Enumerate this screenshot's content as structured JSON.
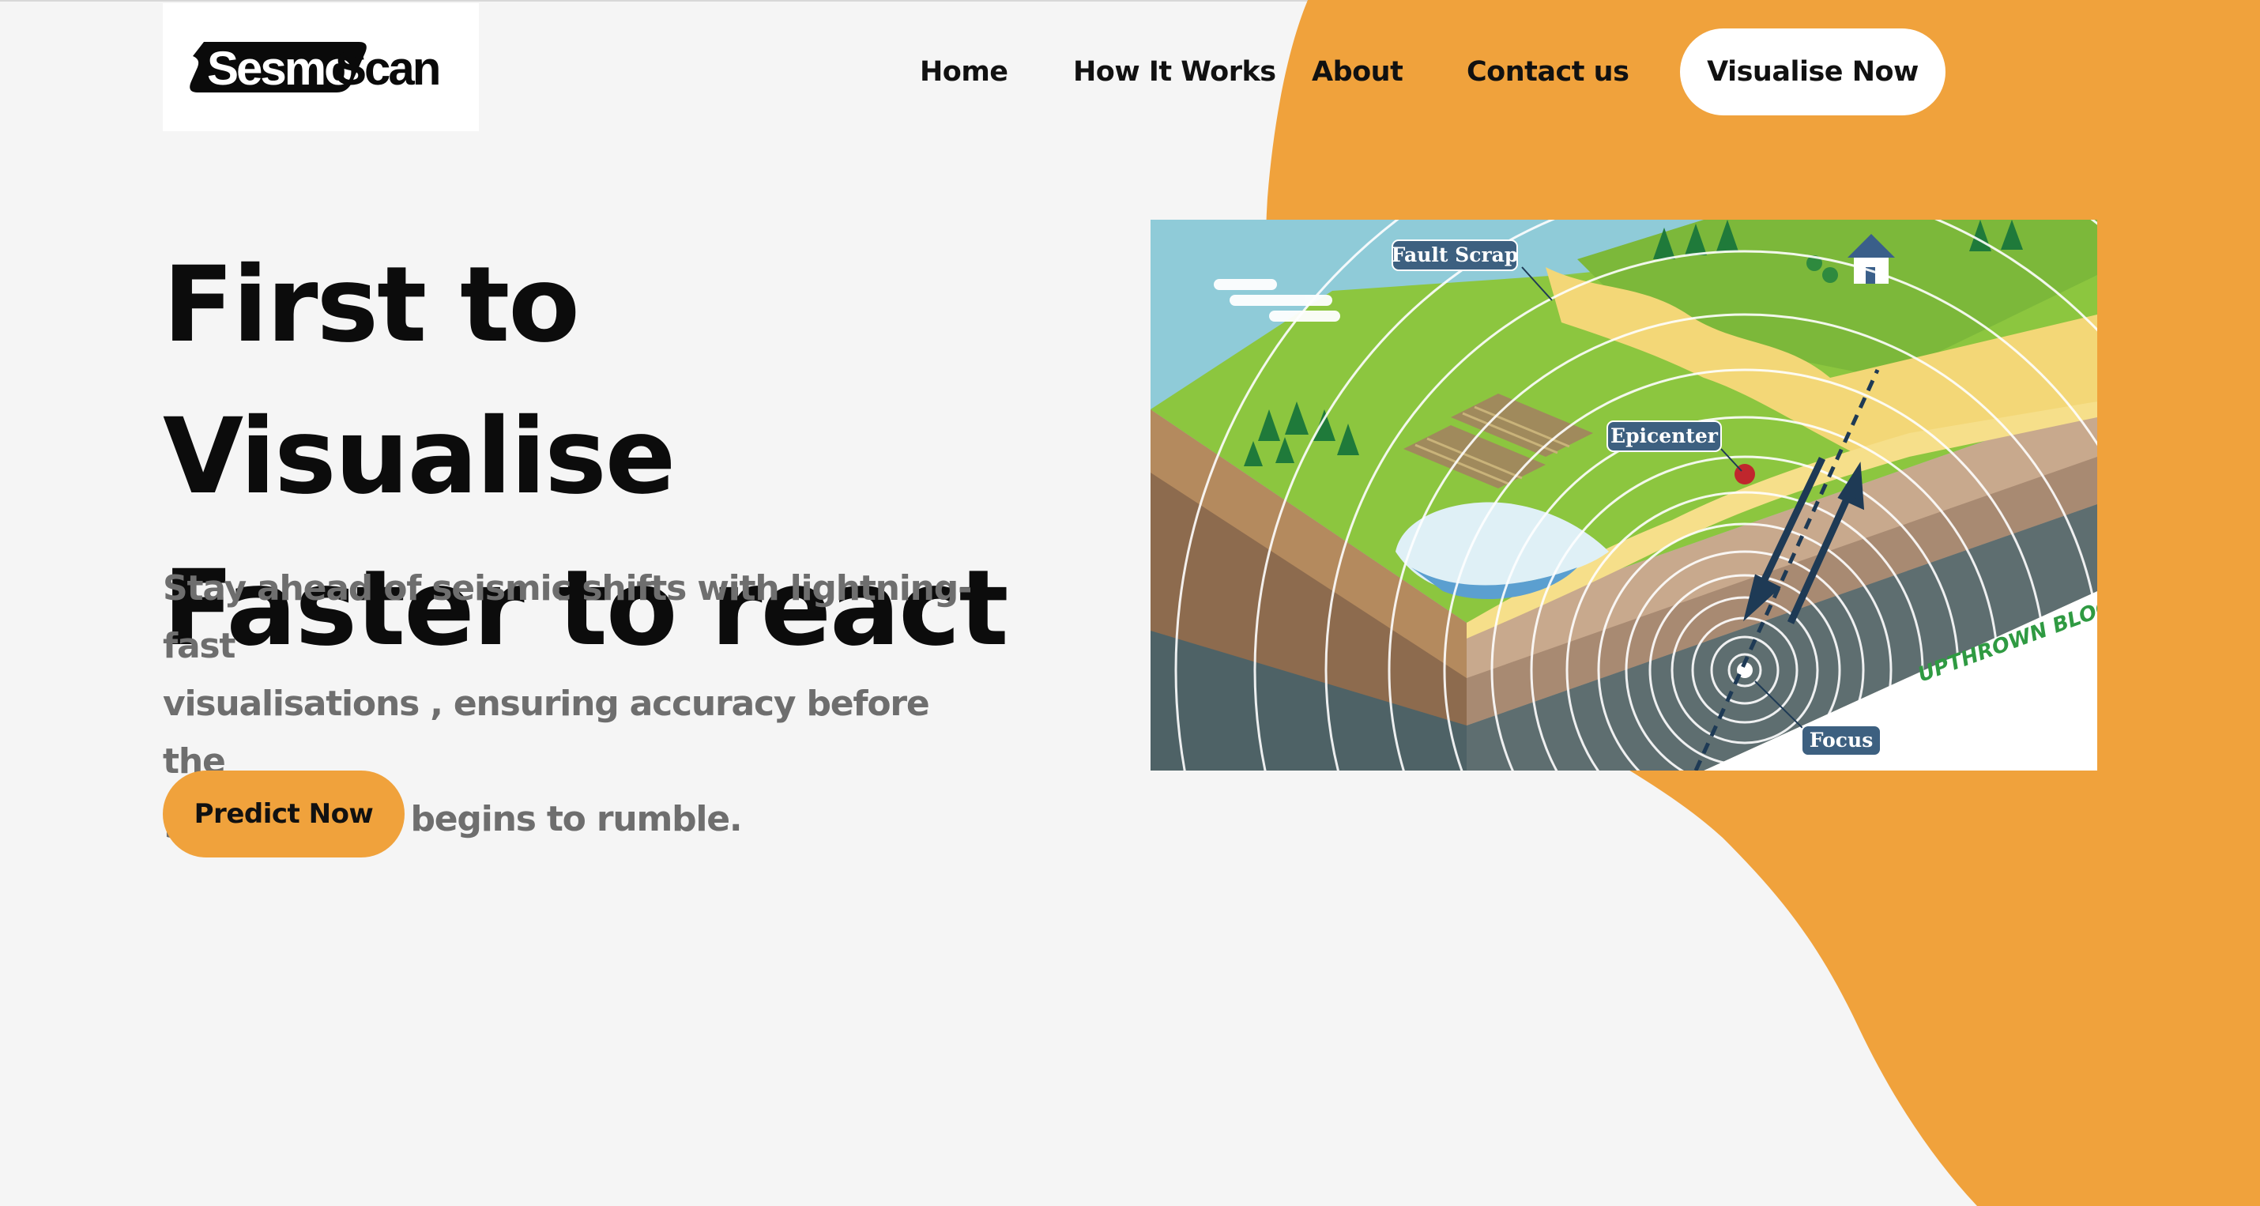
{
  "brand": {
    "name": "SesmoScan",
    "name_part_1": "Sesmo",
    "name_part_2": "Scan"
  },
  "nav": {
    "items": [
      "Home",
      "How It Works",
      "About",
      "Contact us"
    ],
    "cta_label": "Visualise Now"
  },
  "hero": {
    "title_line_1": "First to Visualise",
    "title_line_2": "Faster to react",
    "subtitle_line_1": "Stay ahead of seismic shifts with lightning-fast",
    "subtitle_line_2": "visualisations , ensuring accuracy before the",
    "subtitle_line_3": "ground even begins to rumble.",
    "cta_label": "Predict Now"
  },
  "illustration": {
    "labels": {
      "fault": "Fault Scrap",
      "epicenter": "Epicenter",
      "focus": "Focus",
      "block": "UPTHROWN BLOCK"
    }
  },
  "colors": {
    "accent": "#f0a23c",
    "background": "#f5f5f5",
    "text": "#0c0c0c",
    "muted_text": "#6e6e6e",
    "label_bg": "#3d6080"
  }
}
